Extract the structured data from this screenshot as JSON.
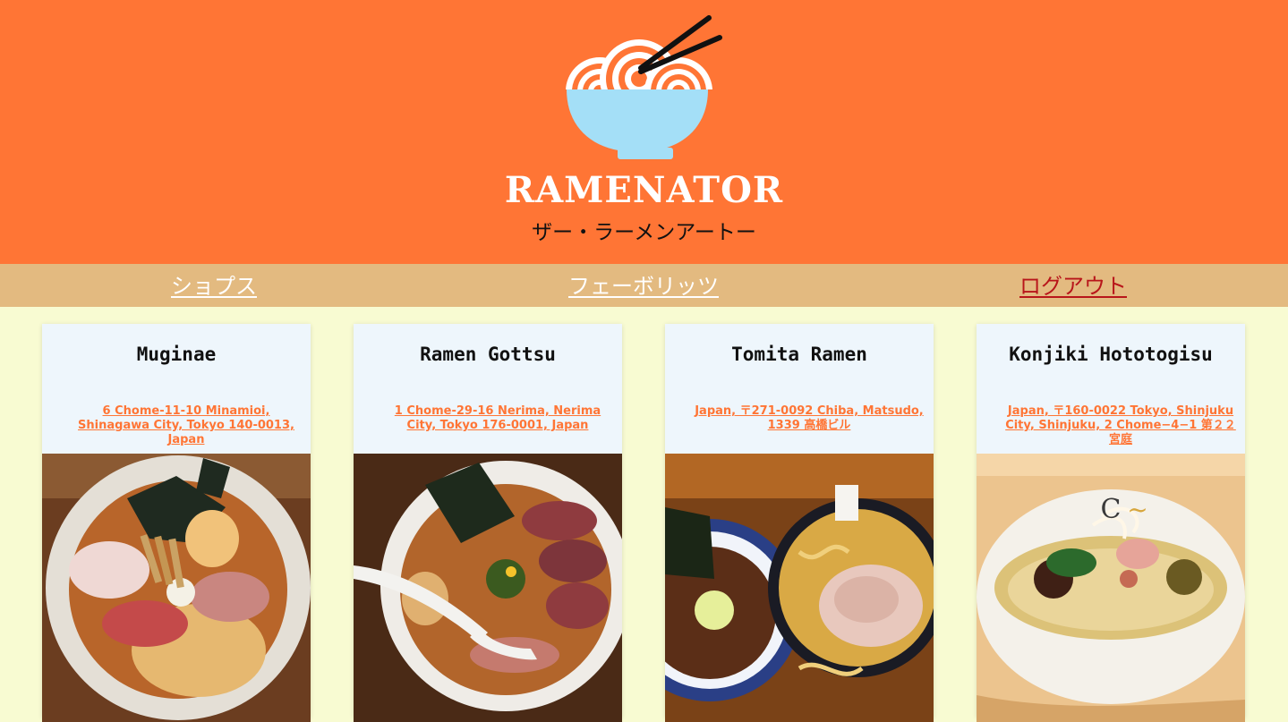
{
  "header": {
    "brand_title": "RAMENATOR",
    "brand_subtitle": "ザー・ラーメンアートー"
  },
  "nav": {
    "shops_label": "ショプス",
    "favorites_label": "フェーボリッツ",
    "logout_label": "ログアウト"
  },
  "shops": [
    {
      "name": "Muginae",
      "address": "6 Chome-11-10 Minamioi, Shinagawa City, Tokyo 140-0013, Japan"
    },
    {
      "name": "Ramen Gottsu",
      "address": "1 Chome-29-16 Nerima, Nerima City, Tokyo 176-0001, Japan"
    },
    {
      "name": "Tomita Ramen",
      "address": "Japan, 〒271-0092 Chiba, Matsudo, 1339 高橋ビル"
    },
    {
      "name": "Konjiki Hototogisu",
      "address": "Japan, 〒160-0022 Tokyo, Shinjuku City, Shinjuku, 2 Chome−4−1 第２２宮庭"
    }
  ],
  "colors": {
    "header_bg": "#FF7535",
    "nav_bg": "#E3BA80",
    "page_bg": "#F8FBD2",
    "card_bg": "#EEF6FC",
    "bowl": "#A4DFF7",
    "logout": "#B8151A"
  }
}
